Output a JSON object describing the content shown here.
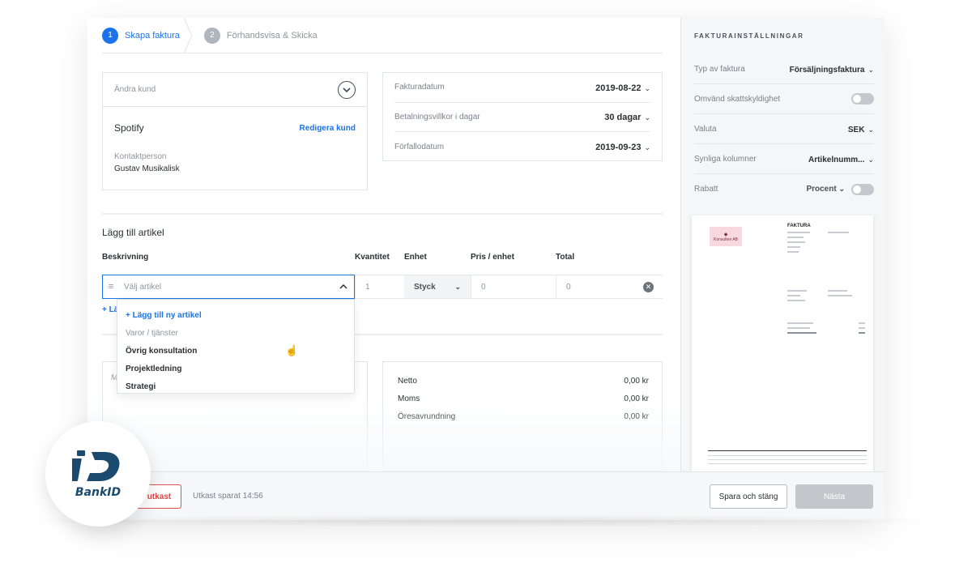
{
  "stepper": {
    "steps": [
      {
        "num": "1",
        "label": "Skapa faktura"
      },
      {
        "num": "2",
        "label": "Förhandsvisa & Skicka"
      }
    ]
  },
  "customer": {
    "change_label": "Ändra kund",
    "name": "Spotify",
    "edit_label": "Redigera kund",
    "contact_label": "Kontaktperson",
    "contact_value": "Gustav Musikalisk"
  },
  "dates": [
    {
      "label": "Fakturadatum",
      "value": "2019-08-22"
    },
    {
      "label": "Betalningsvillkor i dagar",
      "value": "30 dagar"
    },
    {
      "label": "Förfallodatum",
      "value": "2019-09-23"
    }
  ],
  "items": {
    "title": "Lägg till artikel",
    "columns": [
      "Beskrivning",
      "Kvantitet",
      "Enhet",
      "Pris / enhet",
      "Total"
    ],
    "row": {
      "placeholder": "Välj artikel",
      "quantity": "1",
      "unit": "Styck",
      "price": "0",
      "total": "0"
    },
    "add_line_label": "+ Lä"
  },
  "dropdown": {
    "add_new": "+ Lägg till ny artikel",
    "group": "Varor / tjänster",
    "options": [
      "Övrig konsultation",
      "Projektledning",
      "Strategi"
    ]
  },
  "notes": {
    "placeholder": "M"
  },
  "totals": [
    {
      "label": "Netto",
      "value": "0,00 kr"
    },
    {
      "label": "Moms",
      "value": "0,00 kr"
    },
    {
      "label": "Öresavrundning",
      "value": "0,00 kr"
    }
  ],
  "footer": {
    "draft_label": "utkast",
    "saved_text": "Utkast sparat 14:56",
    "save_close_label": "Spara och stäng",
    "next_label": "Nästa"
  },
  "settings": {
    "title": "FAKTURAINSTÄLLNINGAR",
    "invoice_type_label": "Typ av faktura",
    "invoice_type_value": "Försäljningsfaktura",
    "reverse_vat_label": "Omvänd skattskyldighet",
    "currency_label": "Valuta",
    "currency_value": "SEK",
    "columns_label": "Synliga kolumner",
    "columns_value": "Artikelnumm...",
    "discount_label": "Rabatt",
    "discount_value": "Procent"
  },
  "preview": {
    "logo_text": "Konsulten AB",
    "title": "FAKTURA"
  },
  "bankid": {
    "label": "BankID"
  },
  "colors": {
    "accent": "#1a73e8",
    "danger": "#e04545",
    "bankid": "#1a4b6e"
  }
}
